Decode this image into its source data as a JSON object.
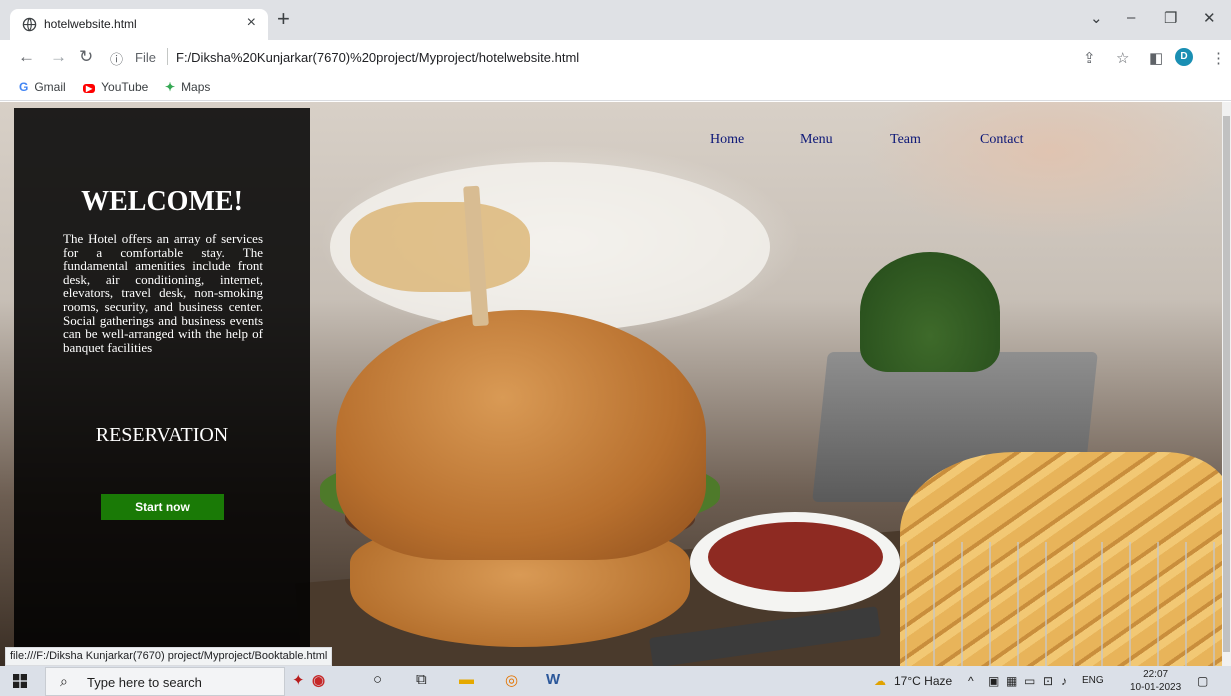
{
  "browser": {
    "tab_title": "hotelwebsite.html",
    "address": {
      "scheme_label": "File",
      "url": "F:/Diksha%20Kunjarkar(7670)%20project/Myproject/hotelwebsite.html"
    },
    "profile_initial": "D",
    "bookmarks": [
      {
        "label": "Gmail",
        "icon": "G"
      },
      {
        "label": "YouTube",
        "icon": "▶"
      },
      {
        "label": "Maps",
        "icon": "✦"
      }
    ],
    "status_url": "file:///F:/Diksha Kunjarkar(7670) project/Myproject/Booktable.html"
  },
  "page": {
    "nav": [
      "Home",
      "Menu",
      "Team",
      "Contact"
    ],
    "welcome_title": "WELCOME!",
    "welcome_text": "The Hotel offers an array of services for a comfortable stay. The fundamental amenities include front desk, air conditioning, internet, elevators, travel desk, non-smoking rooms, security, and business center. Social gatherings and business events can be well-arranged with the help of banquet facilities",
    "reservation_title": "RESERVATION",
    "start_button": "Start now"
  },
  "taskbar": {
    "search_placeholder": "Type here to search",
    "weather": "17°C  Haze",
    "language": "ENG",
    "time": "22:07",
    "date": "10-01-2023"
  },
  "colors": {
    "nav_link": "#0c1777",
    "start_button": "#1a7a06",
    "panel_bg": "#000000"
  }
}
